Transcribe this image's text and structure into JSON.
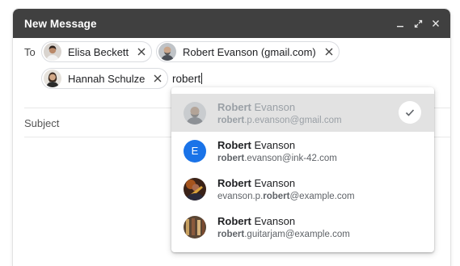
{
  "window": {
    "title": "New Message"
  },
  "compose": {
    "to_label": "To",
    "subject_placeholder": "Subject",
    "typed_query": "robert",
    "recipients": [
      {
        "name": "Elisa Beckett"
      },
      {
        "name": "Robert Evanson (gmail.com)"
      },
      {
        "name": "Hannah Schulze"
      }
    ]
  },
  "suggestions": [
    {
      "name_match": "Robert",
      "name_rest": " Evanson",
      "email_pre": "",
      "email_match": "robert",
      "email_post": ".p.evanson@gmail.com",
      "selected": true,
      "avatar": "photo"
    },
    {
      "name_match": "Robert",
      "name_rest": " Evanson",
      "email_pre": "",
      "email_match": "robert",
      "email_post": ".evanson@ink-42.com",
      "selected": false,
      "avatar": "letter",
      "avatar_letter": "E",
      "avatar_color": "#1a73e8"
    },
    {
      "name_match": "Robert",
      "name_rest": " Evanson",
      "email_pre": "evanson.p.",
      "email_match": "robert",
      "email_post": "@example.com",
      "selected": false,
      "avatar": "photo"
    },
    {
      "name_match": "Robert",
      "name_rest": " Evanson",
      "email_pre": "",
      "email_match": "robert",
      "email_post": ".guitarjam@example.com",
      "selected": false,
      "avatar": "photo"
    }
  ],
  "colors": {
    "titlebar": "#404040",
    "accent": "#1a73e8",
    "selected_row": "#e2e2e2"
  },
  "icons": [
    "minimize-icon",
    "expand-icon",
    "close-icon",
    "remove-chip-icon",
    "check-icon"
  ]
}
